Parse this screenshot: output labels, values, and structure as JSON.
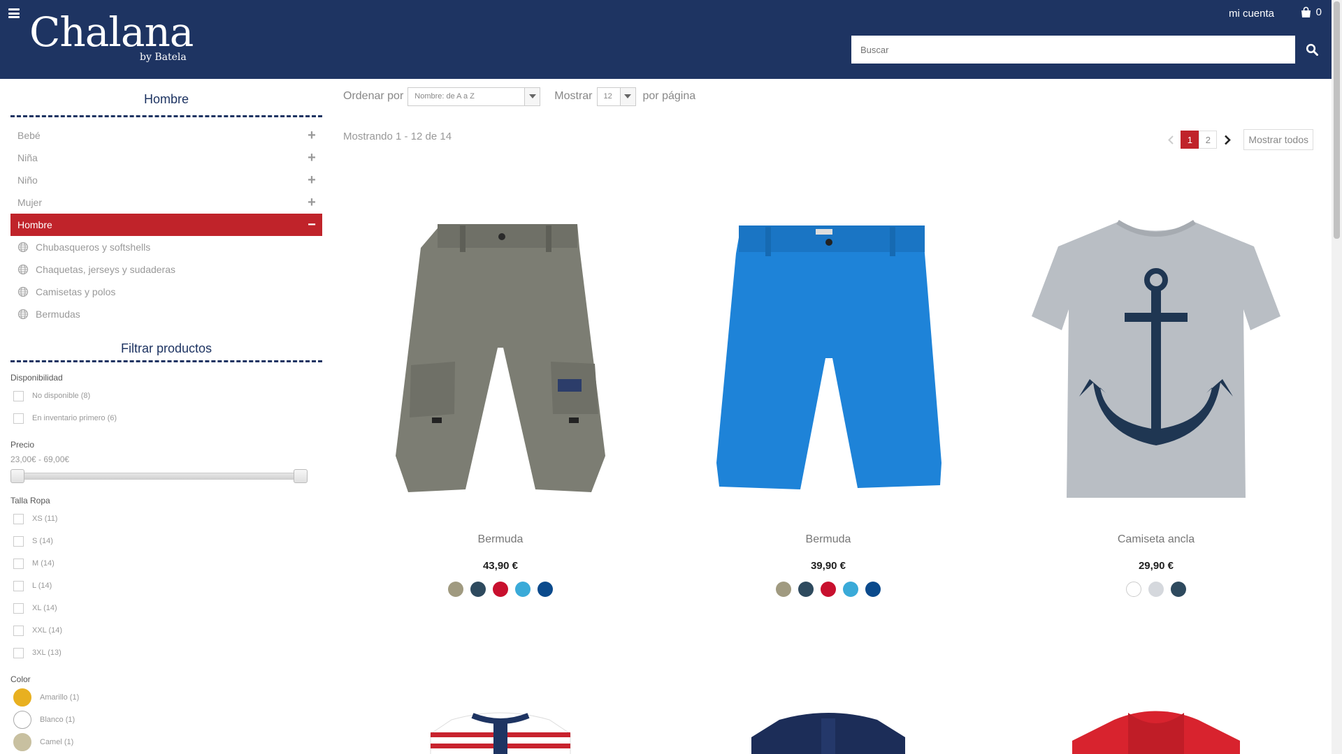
{
  "header": {
    "logo": "Chalana",
    "logo_sub": "by Batela",
    "account": "mi cuenta",
    "cart_count": "0",
    "search_placeholder": "Buscar"
  },
  "sidebar": {
    "title": "Hombre",
    "categories": [
      {
        "label": "Bebé",
        "sign": "+"
      },
      {
        "label": "Niña",
        "sign": "+"
      },
      {
        "label": "Niño",
        "sign": "+"
      },
      {
        "label": "Mujer",
        "sign": "+"
      },
      {
        "label": "Hombre",
        "sign": "−"
      }
    ],
    "subcategories": [
      "Chubasqueros y softshells",
      "Chaquetas, jerseys y sudaderas",
      "Camisetas y polos",
      "Bermudas"
    ],
    "filter_title": "Filtrar productos",
    "availability_label": "Disponibilidad",
    "availability": [
      "No disponible (8)",
      "En inventario primero (6)"
    ],
    "price_label": "Precio",
    "price_range": "23,00€ - 69,00€",
    "size_label": "Talla Ropa",
    "sizes": [
      "XS (11)",
      "S (14)",
      "M (14)",
      "L (14)",
      "XL (14)",
      "XXL (14)",
      "3XL (13)"
    ],
    "color_label": "Color",
    "colors": [
      {
        "label": "Amarillo (1)",
        "hex": "#e8b020"
      },
      {
        "label": "Blanco (1)",
        "hex": "#ffffff"
      },
      {
        "label": "Camel (1)",
        "hex": "#c8c0a0"
      }
    ]
  },
  "toolbar": {
    "sort_label": "Ordenar por",
    "sort_value": "Nombre: de A a Z",
    "show_label": "Mostrar",
    "show_value": "12",
    "per_page": "por página",
    "showing": "Mostrando 1 - 12 de 14",
    "pages": [
      "1",
      "2"
    ],
    "show_all": "Mostrar todos"
  },
  "products": [
    {
      "name": "Bermuda",
      "price": "43,90 €",
      "colors": [
        "#a09a80",
        "#2e4a5e",
        "#c8102e",
        "#3aaad8",
        "#0b4a8c"
      ]
    },
    {
      "name": "Bermuda",
      "price": "39,90 €",
      "colors": [
        "#a09a80",
        "#2e4a5e",
        "#c8102e",
        "#3aaad8",
        "#0b4a8c"
      ]
    },
    {
      "name": "Camiseta ancla",
      "price": "29,90 €",
      "colors": [
        "#ffffff",
        "#d5d8dd",
        "#2e4a5e"
      ]
    }
  ],
  "colors": {
    "navy": "#1e3462",
    "accent_red": "#c0232a"
  }
}
